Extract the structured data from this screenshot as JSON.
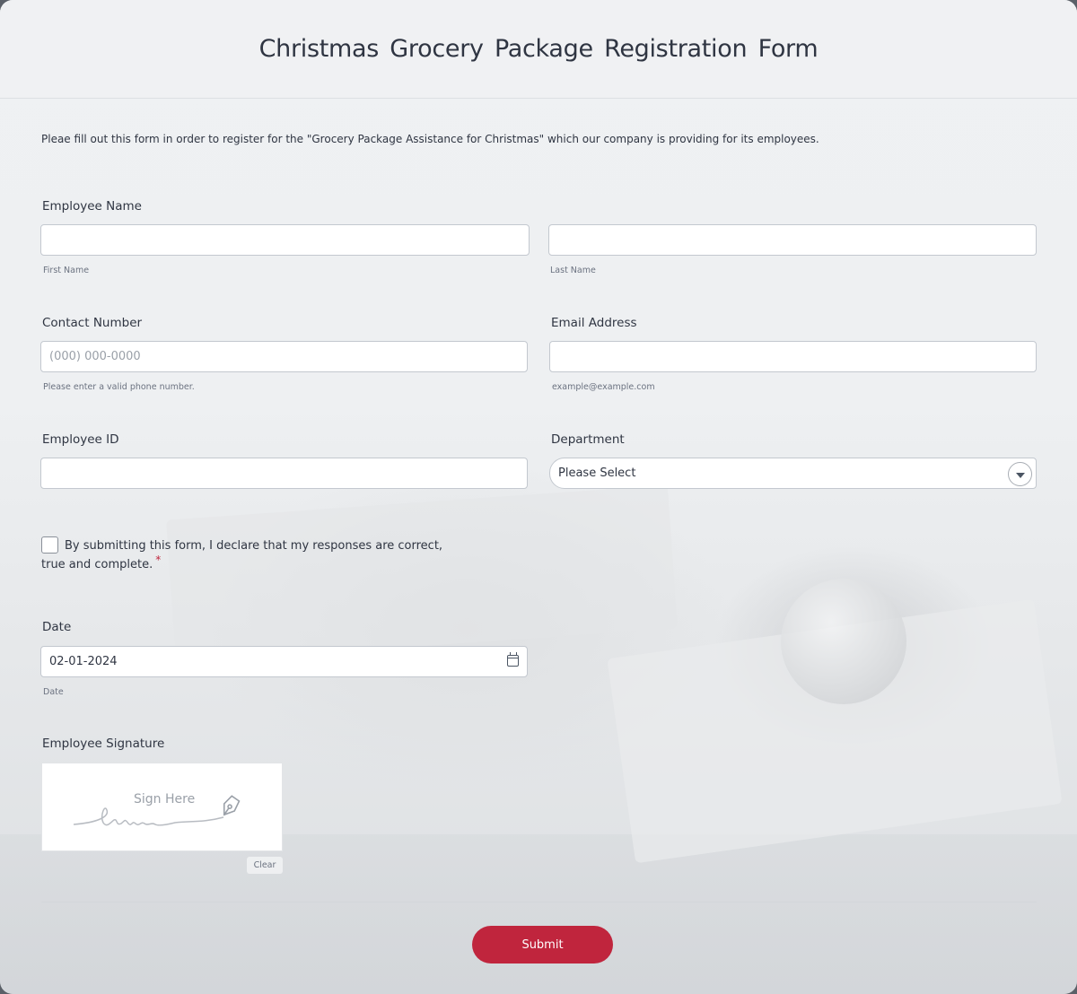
{
  "form": {
    "title": "Christmas Grocery Package Registration Form",
    "intro": "Pleae fill out this form in order to register for the \"Grocery Package Assistance for Christmas\" which our company is providing for its employees."
  },
  "fields": {
    "employee_name": {
      "label": "Employee Name",
      "first_sub": "First Name",
      "last_sub": "Last Name",
      "first_value": "",
      "last_value": ""
    },
    "contact": {
      "label": "Contact Number",
      "placeholder": "(000) 000-0000",
      "sub": "Please enter a valid phone number."
    },
    "email": {
      "label": "Email Address",
      "value": "",
      "sub": "example@example.com"
    },
    "employee_id": {
      "label": "Employee ID",
      "value": ""
    },
    "department": {
      "label": "Department",
      "selected": "Please Select"
    },
    "declaration": {
      "text": "By submitting this form,  I declare that my responses are correct, true and complete.",
      "required_mark": "*",
      "checked": false
    },
    "date": {
      "label": "Date",
      "value": "02-01-2024",
      "sub": "Date"
    },
    "signature": {
      "label": "Employee Signature",
      "placeholder": "Sign Here",
      "clear_label": "Clear"
    }
  },
  "submit_label": "Submit",
  "colors": {
    "accent": "#c0253d",
    "text": "#2f3542",
    "background": "#eff1f3"
  },
  "icons": [
    "calendar-icon",
    "chevron-down-icon",
    "pen-nib-icon"
  ]
}
